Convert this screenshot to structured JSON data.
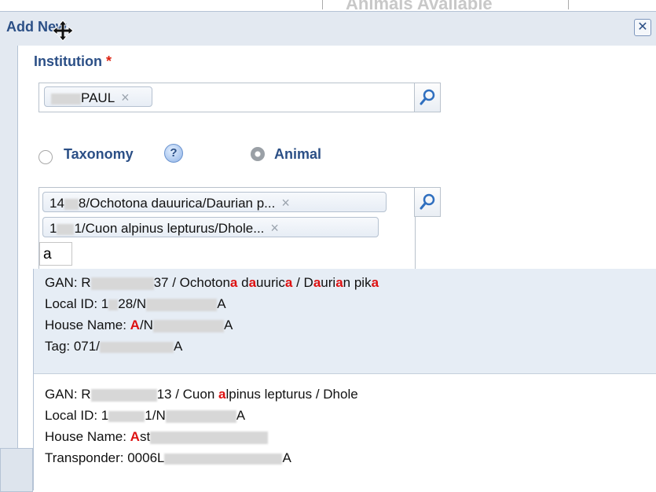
{
  "background": {
    "header_text": "Animals Available"
  },
  "dialog": {
    "title": "Add New",
    "close_symbol": "✕",
    "institution": {
      "label": "Institution",
      "required_mark": "*",
      "token_text": "PAUL",
      "remove_symbol": "×"
    },
    "mode": {
      "options": [
        {
          "label": "Taxonomy",
          "selected": false
        },
        {
          "label": "Animal",
          "selected": true
        }
      ],
      "help_symbol": "?"
    },
    "animals": {
      "tokens": [
        {
          "prefix": "14",
          "text": "8/Ochotona dauurica/Daurian p...",
          "remove_symbol": "×"
        },
        {
          "prefix": "1",
          "text": "1/Cuon alpinus lepturus/Dhole...",
          "remove_symbol": "×"
        }
      ],
      "typed_value": "a"
    },
    "results": [
      {
        "lines": [
          {
            "label": "GAN: R",
            "tail_parts": [
              "37 / Ochoton",
              "a",
              " d",
              "a",
              "uuric",
              "a",
              " / D",
              "a",
              "uri",
              "a",
              "n pik",
              "a"
            ]
          },
          {
            "label": "Local ID: 1",
            "tail_parts": [
              "28/N",
              "",
              "",
              "",
              "",
              "",
              "",
              "",
              "",
              "",
              "",
              "A"
            ]
          },
          {
            "label": "House Name: ",
            "tail_parts": [
              "A",
              "/N",
              "",
              "",
              "",
              "",
              "",
              "",
              "",
              "",
              "",
              "A"
            ]
          },
          {
            "label": "Tag: 071/",
            "tail_parts": [
              "A",
              "",
              "",
              "",
              "",
              "",
              "",
              "",
              "",
              "",
              "",
              ""
            ]
          }
        ]
      },
      {
        "lines": [
          {
            "label": "GAN: R",
            "tail_parts": [
              "13 / Cuon ",
              "a",
              "lpinus lepturus / Dhole",
              "",
              "",
              "",
              "",
              "",
              "",
              "",
              "",
              ""
            ]
          },
          {
            "label": "Local ID: 1",
            "tail_parts": [
              "1/N",
              "",
              "",
              "",
              "",
              "",
              "",
              "",
              "",
              "",
              "",
              "A"
            ]
          },
          {
            "label": "House Name: ",
            "tail_parts": [
              "A",
              "st",
              "",
              "",
              "",
              "",
              "",
              "",
              "",
              "",
              "",
              ""
            ]
          },
          {
            "label": "Transponder: 0006L",
            "tail_parts": [
              "",
              "",
              "",
              "",
              "",
              "",
              "",
              "",
              "",
              "",
              "",
              "A"
            ]
          }
        ]
      }
    ]
  },
  "colors": {
    "title_blue": "#2b4f86",
    "required_red": "#dd2211",
    "highlight_red": "#dd1111",
    "selected_row": "#e6edf5"
  }
}
